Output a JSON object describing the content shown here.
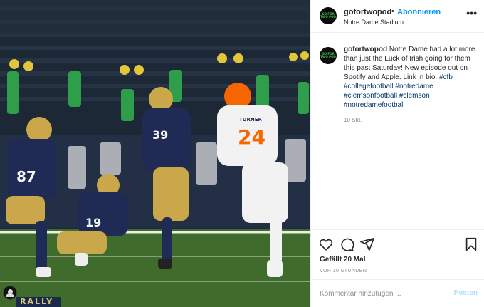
{
  "photo": {
    "jersey_left": "87",
    "jersey_holder": "19",
    "jersey_kicker": "39",
    "jersey_defender": "24",
    "defender_name": "TURNER",
    "banner_text": "RALLY",
    "colors": {
      "navy": "#1f2a55",
      "gold": "#c9a74a",
      "orange": "#f56600",
      "turf": "#3f6b2c"
    }
  },
  "header": {
    "avatar_text": "GO FOR TWO POD",
    "username": "gofortwopod",
    "separator": "•",
    "follow_label": "Abonnieren",
    "location": "Notre Dame Stadium",
    "more_icon": "more-icon"
  },
  "caption": {
    "username": "gofortwopod",
    "text": "Notre Dame had a lot more than just the Luck of Irish going for them this past Saturday! New episode out on Spotify and Apple. Link in bio.",
    "hashtags": [
      "#cfb",
      "#collegefootball",
      "#notredame",
      "#clemsonfootball",
      "#clemson",
      "#notredamefootball"
    ],
    "time": "10 Std."
  },
  "actions": {
    "icons": [
      "heart-icon",
      "comment-icon",
      "share-icon",
      "bookmark-icon"
    ],
    "likes": "Gefällt 20 Mal",
    "ago": "VOR 10 STUNDEN"
  },
  "comment": {
    "placeholder": "Kommentar hinzufügen ...",
    "post_label": "Posten"
  }
}
